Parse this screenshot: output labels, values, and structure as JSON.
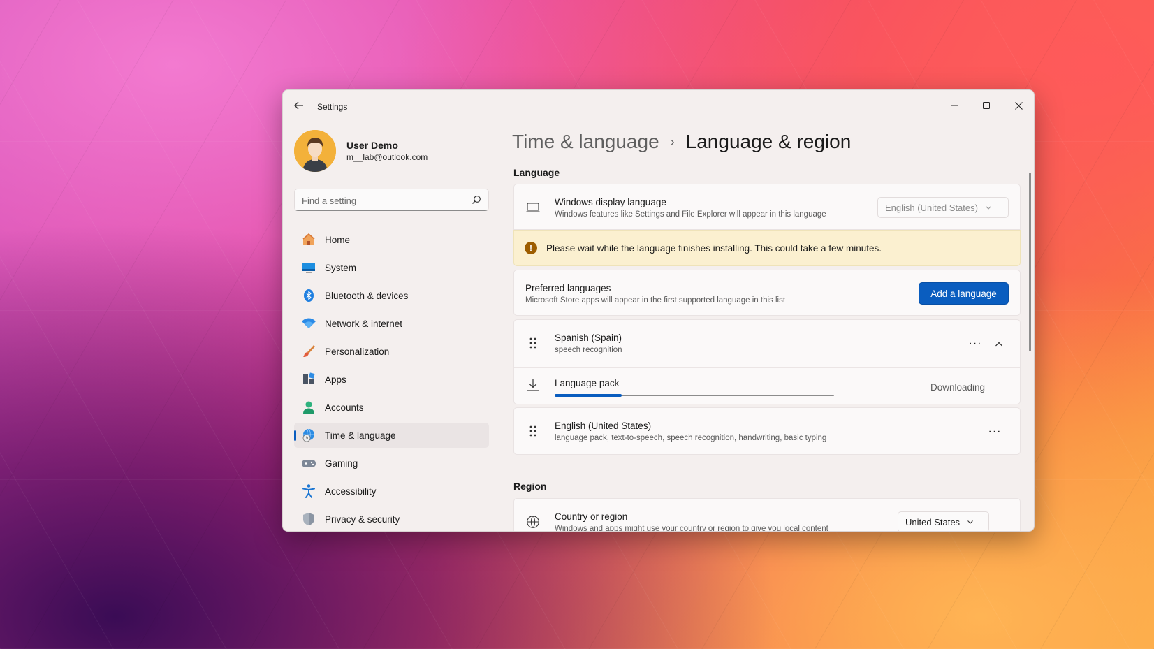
{
  "window": {
    "title": "Settings"
  },
  "profile": {
    "name": "User Demo",
    "email": "m__lab@outlook.com"
  },
  "search": {
    "placeholder": "Find a setting"
  },
  "nav": {
    "items": [
      {
        "label": "Home",
        "icon": "home-icon"
      },
      {
        "label": "System",
        "icon": "system-icon"
      },
      {
        "label": "Bluetooth & devices",
        "icon": "bluetooth-icon"
      },
      {
        "label": "Network & internet",
        "icon": "wifi-icon"
      },
      {
        "label": "Personalization",
        "icon": "brush-icon"
      },
      {
        "label": "Apps",
        "icon": "apps-icon"
      },
      {
        "label": "Accounts",
        "icon": "accounts-icon"
      },
      {
        "label": "Time & language",
        "icon": "globe-clock-icon",
        "selected": true
      },
      {
        "label": "Gaming",
        "icon": "gamepad-icon"
      },
      {
        "label": "Accessibility",
        "icon": "accessibility-icon"
      },
      {
        "label": "Privacy & security",
        "icon": "shield-icon"
      }
    ]
  },
  "breadcrumb": {
    "parent": "Time & language",
    "separator": "›",
    "current": "Language & region"
  },
  "language": {
    "section_title": "Language",
    "display_language": {
      "title": "Windows display language",
      "subtitle": "Windows features like Settings and File Explorer will appear in this language",
      "value": "English (United States)"
    },
    "warning": {
      "text": "Please wait while the language finishes installing. This could take a few minutes."
    },
    "preferred": {
      "title": "Preferred languages",
      "subtitle": "Microsoft Store apps will appear in the first supported language in this list",
      "button": "Add a language"
    },
    "spanish": {
      "title": "Spanish (Spain)",
      "subtitle": "speech recognition",
      "more": "···"
    },
    "language_pack": {
      "title": "Language pack",
      "status": "Downloading",
      "progress": 0.24
    },
    "english": {
      "title": "English (United States)",
      "subtitle": "language pack, text-to-speech, speech recognition, handwriting, basic typing",
      "more": "···"
    }
  },
  "region": {
    "section_title": "Region",
    "country": {
      "title": "Country or region",
      "subtitle": "Windows and apps might use your country or region to give you local content",
      "value": "United States"
    }
  },
  "colors": {
    "accent": "#0a5dbf",
    "warning_bg": "#fbf0d0",
    "warning_icon": "#9d5d00"
  }
}
